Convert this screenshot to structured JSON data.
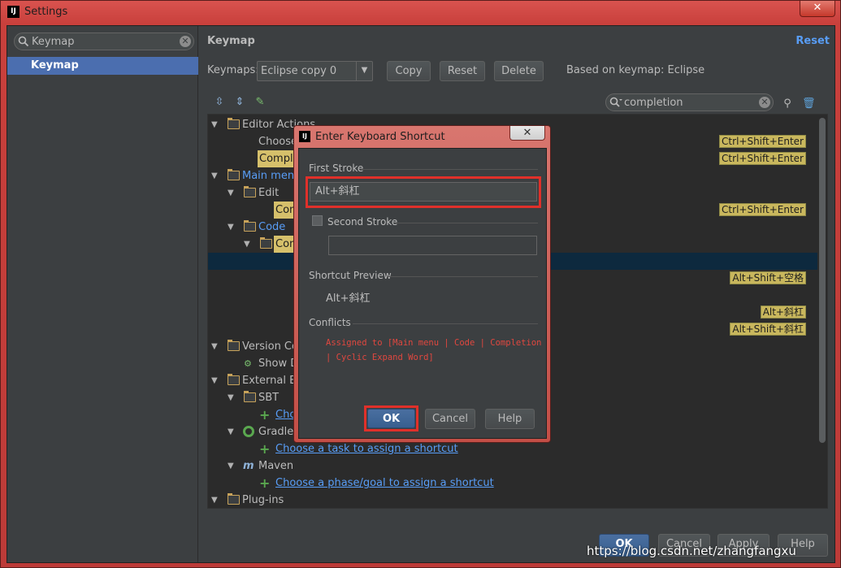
{
  "window": {
    "title": "Settings",
    "logo": "IJ",
    "close": "✕"
  },
  "left": {
    "search_value": "Keymap",
    "items": [
      {
        "label": "Keymap"
      }
    ]
  },
  "right": {
    "title": "Keymap",
    "reset_link": "Reset",
    "keymaps_label": "Keymaps:",
    "keymap_selected": "Eclipse copy 0",
    "copy_label": "Copy",
    "reset_label": "Reset",
    "delete_label": "Delete",
    "based_on": "Based on keymap: Eclipse",
    "filter_value": "completion"
  },
  "tree": {
    "editor_actions": "Editor Actions",
    "choose": "Choose",
    "comple": "Comple",
    "main_menu": "Main menu",
    "edit": "Edit",
    "con1": "Con",
    "code": "Code",
    "con2": "Con",
    "version_co": "Version Co",
    "show_d": "Show D",
    "external_bu": "External Bu",
    "sbt": "SBT",
    "cho": "Cho",
    "gradle": "Gradle",
    "gradle_task": "Choose a task to assign a shortcut",
    "maven": "Maven",
    "maven_task": "Choose a phase/goal to assign a shortcut",
    "plugins": "Plug-ins",
    "shortcuts": {
      "s1": "Ctrl+Shift+Enter",
      "s2": "Ctrl+Shift+Enter",
      "s3": "Ctrl+Shift+Enter",
      "s4": "Alt+Shift+空格",
      "s5": "Alt+斜杠",
      "s6": "Alt+Shift+斜杠"
    }
  },
  "bottom": {
    "ok": "OK",
    "cancel": "Cancel",
    "apply": "Apply",
    "help": "Help"
  },
  "watermark": "https://blog.csdn.net/zhangfangxu",
  "dialog": {
    "title": "Enter Keyboard Shortcut",
    "close": "✕",
    "first_stroke_label": "First Stroke",
    "first_stroke_value": "Alt+斜杠",
    "second_stroke_label": "Second Stroke",
    "second_stroke_value": "",
    "preview_label": "Shortcut Preview",
    "preview_value": "Alt+斜杠",
    "conflicts_label": "Conflicts",
    "conflict_line1": "Assigned to [Main menu | Code | Completion",
    "conflict_line2": "| Cyclic Expand Word]",
    "ok": "OK",
    "cancel": "Cancel",
    "help": "Help"
  },
  "colors": {
    "accent": "#4b6eaf",
    "link": "#589df6",
    "highlight": "#d6c06b",
    "conflict": "#e0473f",
    "callout": "#e0302a"
  }
}
